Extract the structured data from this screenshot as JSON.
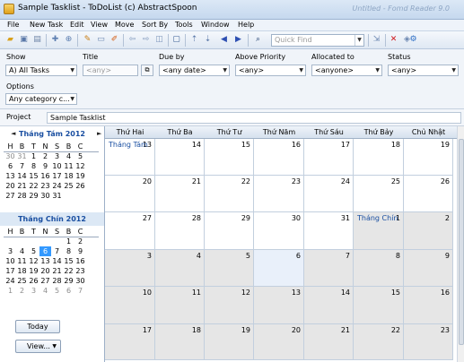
{
  "window": {
    "title": "Sample Tasklist - ToDoList (c) AbstractSpoon",
    "ghost_title": "Untitled - Fomd Reader 9.0"
  },
  "menu": [
    "File",
    "New Task",
    "Edit",
    "View",
    "Move",
    "Sort By",
    "Tools",
    "Window",
    "Help"
  ],
  "toolbar": {
    "quick_find_placeholder": "Quick Find"
  },
  "filters": {
    "show_label": "Show",
    "show_value": "A)  All Tasks",
    "title_label": "Title",
    "title_value": "<any>",
    "due_label": "Due by",
    "due_value": "<any date>",
    "priority_label": "Above Priority",
    "priority_value": "<any>",
    "allocated_label": "Allocated to",
    "allocated_value": "<anyone>",
    "status_label": "Status",
    "status_value": "<any>",
    "options_label": "Options",
    "options_value": "Any category c..."
  },
  "project": {
    "label": "Project",
    "value": "Sample Tasklist"
  },
  "minical": {
    "month1": {
      "title": "Tháng Tám 2012",
      "prev": "◄",
      "next": "►",
      "days": [
        "H",
        "B",
        "T",
        "N",
        "S",
        "B",
        "C"
      ],
      "rows": [
        [
          "30",
          "31",
          "1",
          "2",
          "3",
          "4",
          "5"
        ],
        [
          "6",
          "7",
          "8",
          "9",
          "10",
          "11",
          "12"
        ],
        [
          "13",
          "14",
          "15",
          "16",
          "17",
          "18",
          "19"
        ],
        [
          "20",
          "21",
          "22",
          "23",
          "24",
          "25",
          "26"
        ],
        [
          "27",
          "28",
          "29",
          "30",
          "31",
          "",
          ""
        ]
      ]
    },
    "month2": {
      "title": "Tháng Chín 2012",
      "days": [
        "H",
        "B",
        "T",
        "N",
        "S",
        "B",
        "C"
      ],
      "rows": [
        [
          "",
          "",
          "",
          "",
          "",
          "1",
          "2"
        ],
        [
          "3",
          "4",
          "5",
          "6",
          "7",
          "8",
          "9"
        ],
        [
          "10",
          "11",
          "12",
          "13",
          "14",
          "15",
          "16"
        ],
        [
          "17",
          "18",
          "19",
          "20",
          "21",
          "22",
          "23"
        ],
        [
          "24",
          "25",
          "26",
          "27",
          "28",
          "29",
          "30"
        ],
        [
          "1",
          "2",
          "3",
          "4",
          "5",
          "6",
          "7"
        ]
      ]
    },
    "today_button": "Today",
    "view_button": "View..."
  },
  "calendar": {
    "weekdays": [
      "Thứ Hai",
      "Thứ Ba",
      "Thứ Tư",
      "Thứ Năm",
      "Thứ Sáu",
      "Thứ Bảy",
      "Chủ Nhật"
    ],
    "weeks": [
      [
        {
          "d": "13",
          "m": "Tháng Tám"
        },
        {
          "d": "14"
        },
        {
          "d": "15"
        },
        {
          "d": "16"
        },
        {
          "d": "17"
        },
        {
          "d": "18"
        },
        {
          "d": "19"
        }
      ],
      [
        {
          "d": "20"
        },
        {
          "d": "21"
        },
        {
          "d": "22"
        },
        {
          "d": "23"
        },
        {
          "d": "24"
        },
        {
          "d": "25"
        },
        {
          "d": "26"
        }
      ],
      [
        {
          "d": "27"
        },
        {
          "d": "28"
        },
        {
          "d": "29"
        },
        {
          "d": "30"
        },
        {
          "d": "31"
        },
        {
          "d": "1",
          "m": "Tháng Chín",
          "g": 1
        },
        {
          "d": "2",
          "g": 1
        }
      ],
      [
        {
          "d": "3",
          "g": 1
        },
        {
          "d": "4",
          "g": 1
        },
        {
          "d": "5",
          "g": 1
        },
        {
          "d": "6",
          "t": 1
        },
        {
          "d": "7",
          "g": 1
        },
        {
          "d": "8",
          "g": 1
        },
        {
          "d": "9",
          "g": 1
        }
      ],
      [
        {
          "d": "10",
          "g": 1
        },
        {
          "d": "11",
          "g": 1
        },
        {
          "d": "12",
          "g": 1
        },
        {
          "d": "13",
          "g": 1
        },
        {
          "d": "14",
          "g": 1
        },
        {
          "d": "15",
          "g": 1
        },
        {
          "d": "16",
          "g": 1
        }
      ],
      [
        {
          "d": "17",
          "g": 1
        },
        {
          "d": "18",
          "g": 1
        },
        {
          "d": "19",
          "g": 1
        },
        {
          "d": "20",
          "g": 1
        },
        {
          "d": "21",
          "g": 1
        },
        {
          "d": "22",
          "g": 1
        },
        {
          "d": "23",
          "g": 1
        }
      ]
    ]
  }
}
